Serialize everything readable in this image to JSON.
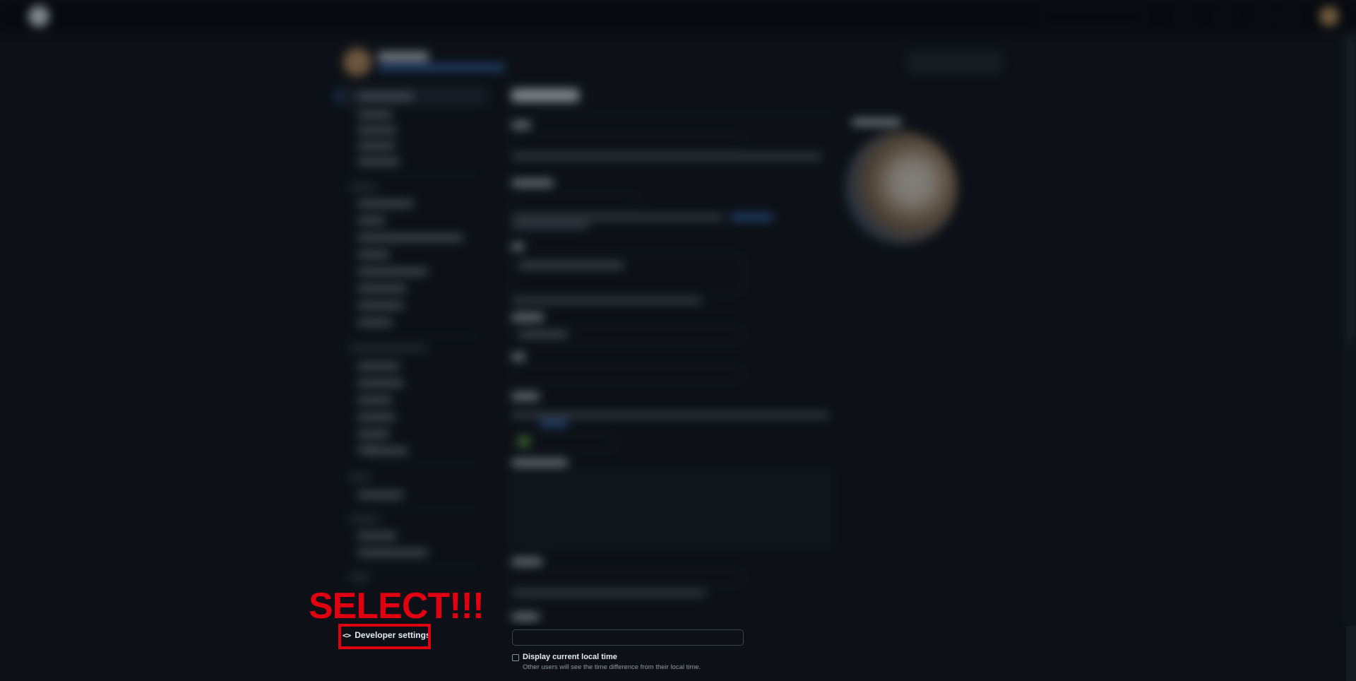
{
  "annotation": {
    "callout": "SELECT!!!",
    "color": "#e0000f"
  },
  "bottom": {
    "developer_settings": {
      "label": "Developer settings",
      "icon": "code-icon",
      "icon_glyph": "<>"
    },
    "field": {
      "value": ""
    },
    "local_time": {
      "label": "Display current local time",
      "description": "Other users will see the time difference from their local time.",
      "checked": false
    }
  },
  "colors": {
    "background": "#0d1117",
    "text": "#e6edf3",
    "muted": "#9198a1",
    "border": "#3d444d",
    "link": "#4493f8"
  }
}
